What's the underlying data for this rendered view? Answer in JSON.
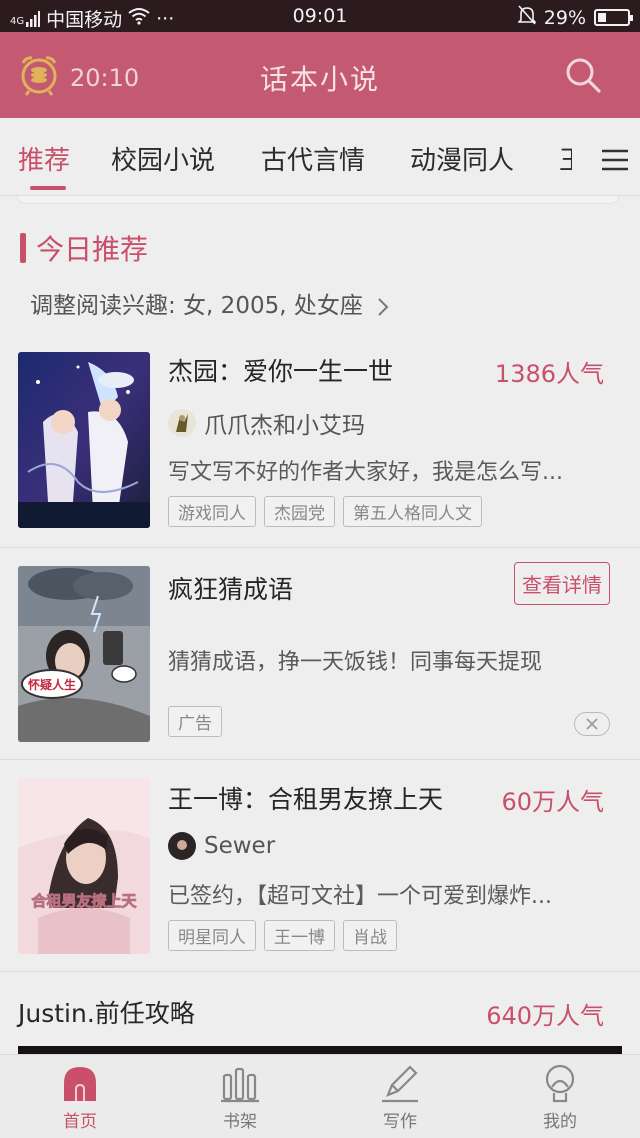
{
  "status_bar": {
    "network": "4G",
    "carrier": "中国移动",
    "dots": "···",
    "time": "09:01",
    "battery": "29%",
    "battery_level": 0.29
  },
  "header": {
    "clock_time": "20:10",
    "title": "话本小说"
  },
  "tabs": [
    {
      "label": "推荐",
      "active": true
    },
    {
      "label": "校园小说"
    },
    {
      "label": "古代言情"
    },
    {
      "label": "动漫同人"
    },
    {
      "label": "王"
    }
  ],
  "section": {
    "title": "今日推荐",
    "interest": "调整阅读兴趣: 女, 2005, 处女座"
  },
  "items": [
    {
      "title": "杰园：爱你一生一世",
      "popularity": "1386人气",
      "author": "爪爪杰和小艾玛",
      "desc": "写文写不好的作者大家好，我是怎么写...",
      "tags": [
        "游戏同人",
        "杰园党",
        "第五人格同人文"
      ]
    },
    {
      "ad": true,
      "title": "疯狂猜成语",
      "button": "查看详情",
      "desc": "猜猜成语，挣一天饭钱！同事每天提现",
      "ad_tag": "广告",
      "cover_text": "怀疑人生"
    },
    {
      "title": "王一博：合租男友撩上天",
      "popularity": "60万人气",
      "author": "Sewer",
      "desc": "已签约，【超可文社】一个可爱到爆炸...",
      "tags": [
        "明星同人",
        "王一博",
        "肖战"
      ],
      "cover_text": "合租男友撩上天"
    },
    {
      "title": "Justin.前任攻略",
      "popularity": "640万人气"
    }
  ],
  "bottom_nav": [
    {
      "label": "首页",
      "icon": "home-icon",
      "active": true
    },
    {
      "label": "书架",
      "icon": "bookshelf-icon"
    },
    {
      "label": "写作",
      "icon": "pen-icon"
    },
    {
      "label": "我的",
      "icon": "profile-icon"
    }
  ],
  "colors": {
    "brand": "#c35a71",
    "accent": "#c8506a",
    "background": "#efeeee"
  }
}
